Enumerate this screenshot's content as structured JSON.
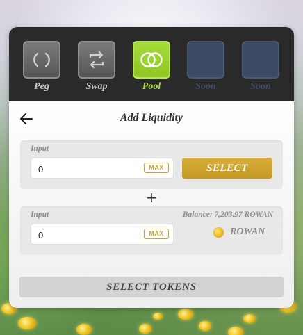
{
  "nav": {
    "items": [
      {
        "label": "Peg",
        "icon": "peg-icon",
        "state": "inactive"
      },
      {
        "label": "Swap",
        "icon": "swap-icon",
        "state": "inactive"
      },
      {
        "label": "Pool",
        "icon": "pool-icon",
        "state": "active"
      },
      {
        "label": "Soon",
        "icon": "placeholder-icon",
        "state": "disabled"
      },
      {
        "label": "Soon",
        "icon": "placeholder-icon",
        "state": "disabled"
      }
    ]
  },
  "header": {
    "title": "Add Liquidity",
    "back_icon": "arrow-left-icon"
  },
  "from_token": {
    "label": "Input",
    "amount": "0",
    "max_label": "MAX",
    "select_label": "SELECT"
  },
  "plus": "+",
  "to_token": {
    "label": "Input",
    "amount": "0",
    "max_label": "MAX",
    "balance": "Balance: 7,203.97 ROWAN",
    "token_symbol": "ROWAN",
    "token_icon": "rowan-coin-icon"
  },
  "action": {
    "label": "SELECT TOKENS"
  },
  "colors": {
    "nav_bg": "#2a2a2a",
    "active_green": "#a6d93a",
    "gold": "#c9a232",
    "disabled_blue": "#3c4a63"
  }
}
